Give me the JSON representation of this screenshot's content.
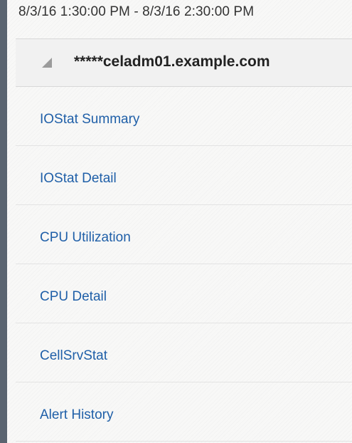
{
  "header": {
    "time_range": "8/3/16 1:30:00 PM - 8/3/16 2:30:00 PM"
  },
  "host": {
    "name": "*****celadm01.example.com",
    "expand_icon": "collapse-triangle-icon"
  },
  "nav": {
    "items": [
      {
        "label": "IOStat Summary"
      },
      {
        "label": "IOStat Detail"
      },
      {
        "label": "CPU Utilization"
      },
      {
        "label": "CPU Detail"
      },
      {
        "label": "CellSrvStat"
      },
      {
        "label": "Alert History"
      }
    ]
  },
  "colors": {
    "link": "#1f5fa8",
    "rail": "#5a6470",
    "header_bg": "#f1f1f1"
  }
}
